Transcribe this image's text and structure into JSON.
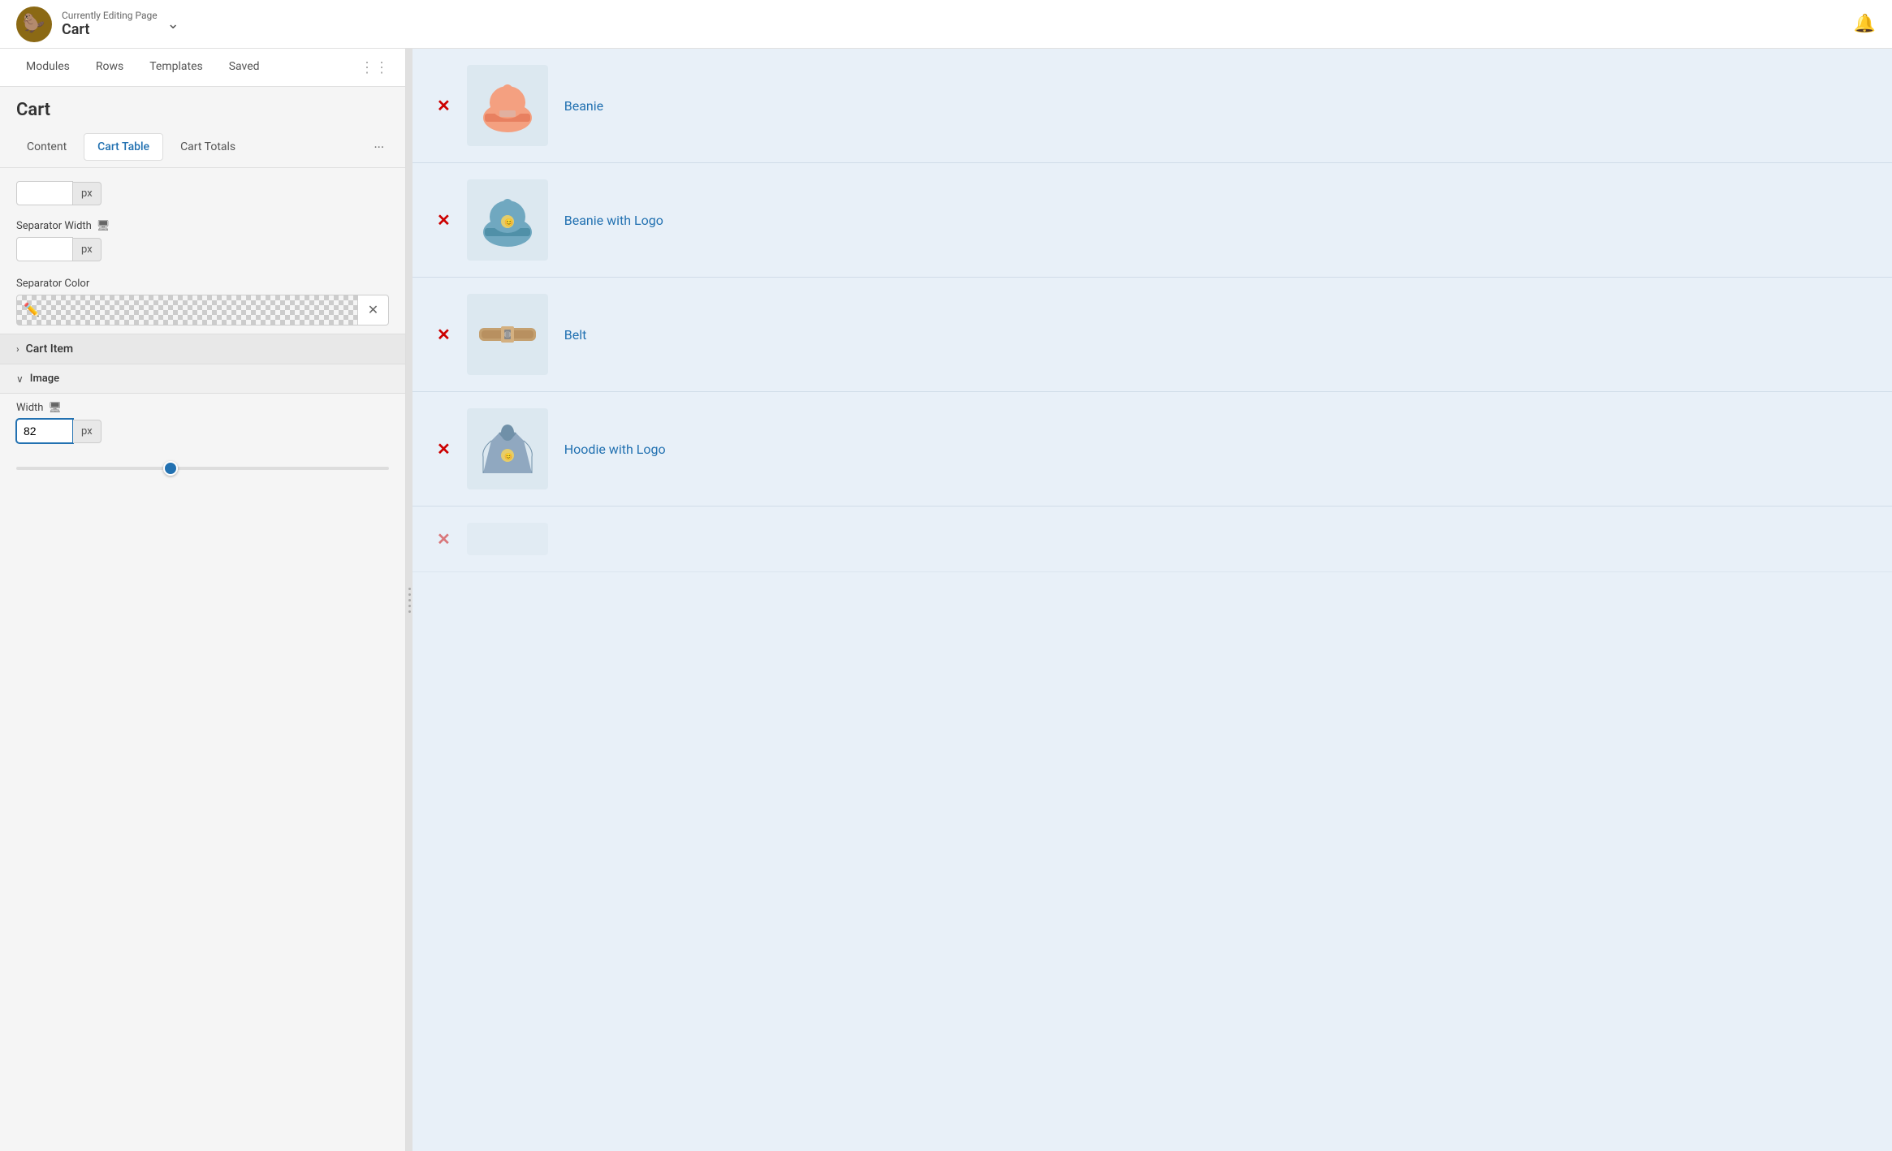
{
  "header": {
    "editing_label": "Currently Editing Page",
    "page_title": "Cart",
    "logo_emoji": "🦫",
    "bell_icon": "🔔",
    "chevron": "⌄"
  },
  "top_tabs": {
    "items": [
      "Modules",
      "Rows",
      "Templates",
      "Saved"
    ]
  },
  "section": {
    "title": "Cart"
  },
  "sub_tabs": {
    "items": [
      "Content",
      "Cart Table",
      "Cart Totals"
    ],
    "active": "Cart Table",
    "more": "···"
  },
  "fields": {
    "separator_width_label": "Separator Width",
    "separator_color_label": "Separator Color",
    "unit": "px",
    "separator_width_value": "",
    "width_label": "Width",
    "width_value": "82",
    "cart_item_section": "Cart Item",
    "image_section": "Image"
  },
  "cart_items": [
    {
      "id": 1,
      "name": "Beanie",
      "emoji": "🧢",
      "color": "#f0a090"
    },
    {
      "id": 2,
      "name": "Beanie with Logo",
      "emoji": "🧢",
      "color": "#80b0c0"
    },
    {
      "id": 3,
      "name": "Belt",
      "emoji": "👜",
      "color": "#c4a882"
    },
    {
      "id": 4,
      "name": "Hoodie with Logo",
      "emoji": "🧥",
      "color": "#90a8c0"
    }
  ],
  "icons": {
    "monitor": "🖥",
    "eyedropper": "✏️",
    "clear": "✕",
    "chevron_right": "›",
    "chevron_down": "∨",
    "remove": "✕"
  }
}
